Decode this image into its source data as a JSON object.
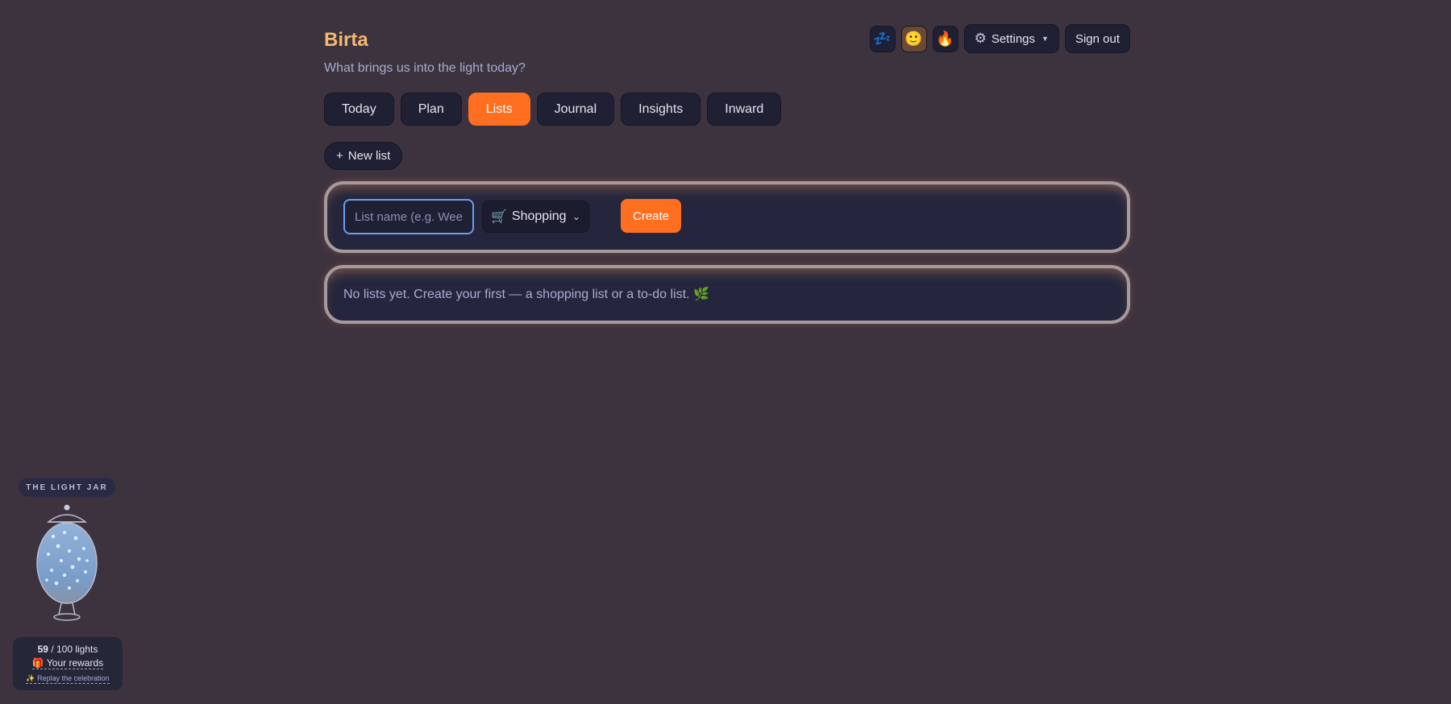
{
  "header": {
    "brand": "Birta",
    "tagline": "What brings us into the light today?",
    "mood_buttons": [
      {
        "icon": "sleep-icon",
        "glyph": "💤"
      },
      {
        "icon": "smile-icon",
        "glyph": "🙂"
      },
      {
        "icon": "fire-icon",
        "glyph": "🔥"
      }
    ],
    "settings_label": "Settings",
    "signout_label": "Sign out"
  },
  "tabs": [
    {
      "label": "Today"
    },
    {
      "label": "Plan"
    },
    {
      "label": "Lists",
      "active": true
    },
    {
      "label": "Journal"
    },
    {
      "label": "Insights"
    },
    {
      "label": "Inward"
    }
  ],
  "lists": {
    "new_list_label": "New list",
    "name_placeholder": "List name (e.g. Weekly shop)",
    "type_select": {
      "glyph": "🛒",
      "label": "Shopping"
    },
    "create_label": "Create",
    "empty_message": "No lists yet. Create your first — a shopping list or a to-do list. 🌿"
  },
  "jar": {
    "title": "THE LIGHT JAR",
    "lights_count": "59",
    "lights_total": "/ 100 lights",
    "rewards_label": "🎁 Your rewards",
    "replay_label": "✨ Replay the celebration"
  },
  "colors": {
    "accent": "#ff6f1f",
    "brand": "#f4b872",
    "background": "#3d333f",
    "surface": "#1f2034"
  }
}
